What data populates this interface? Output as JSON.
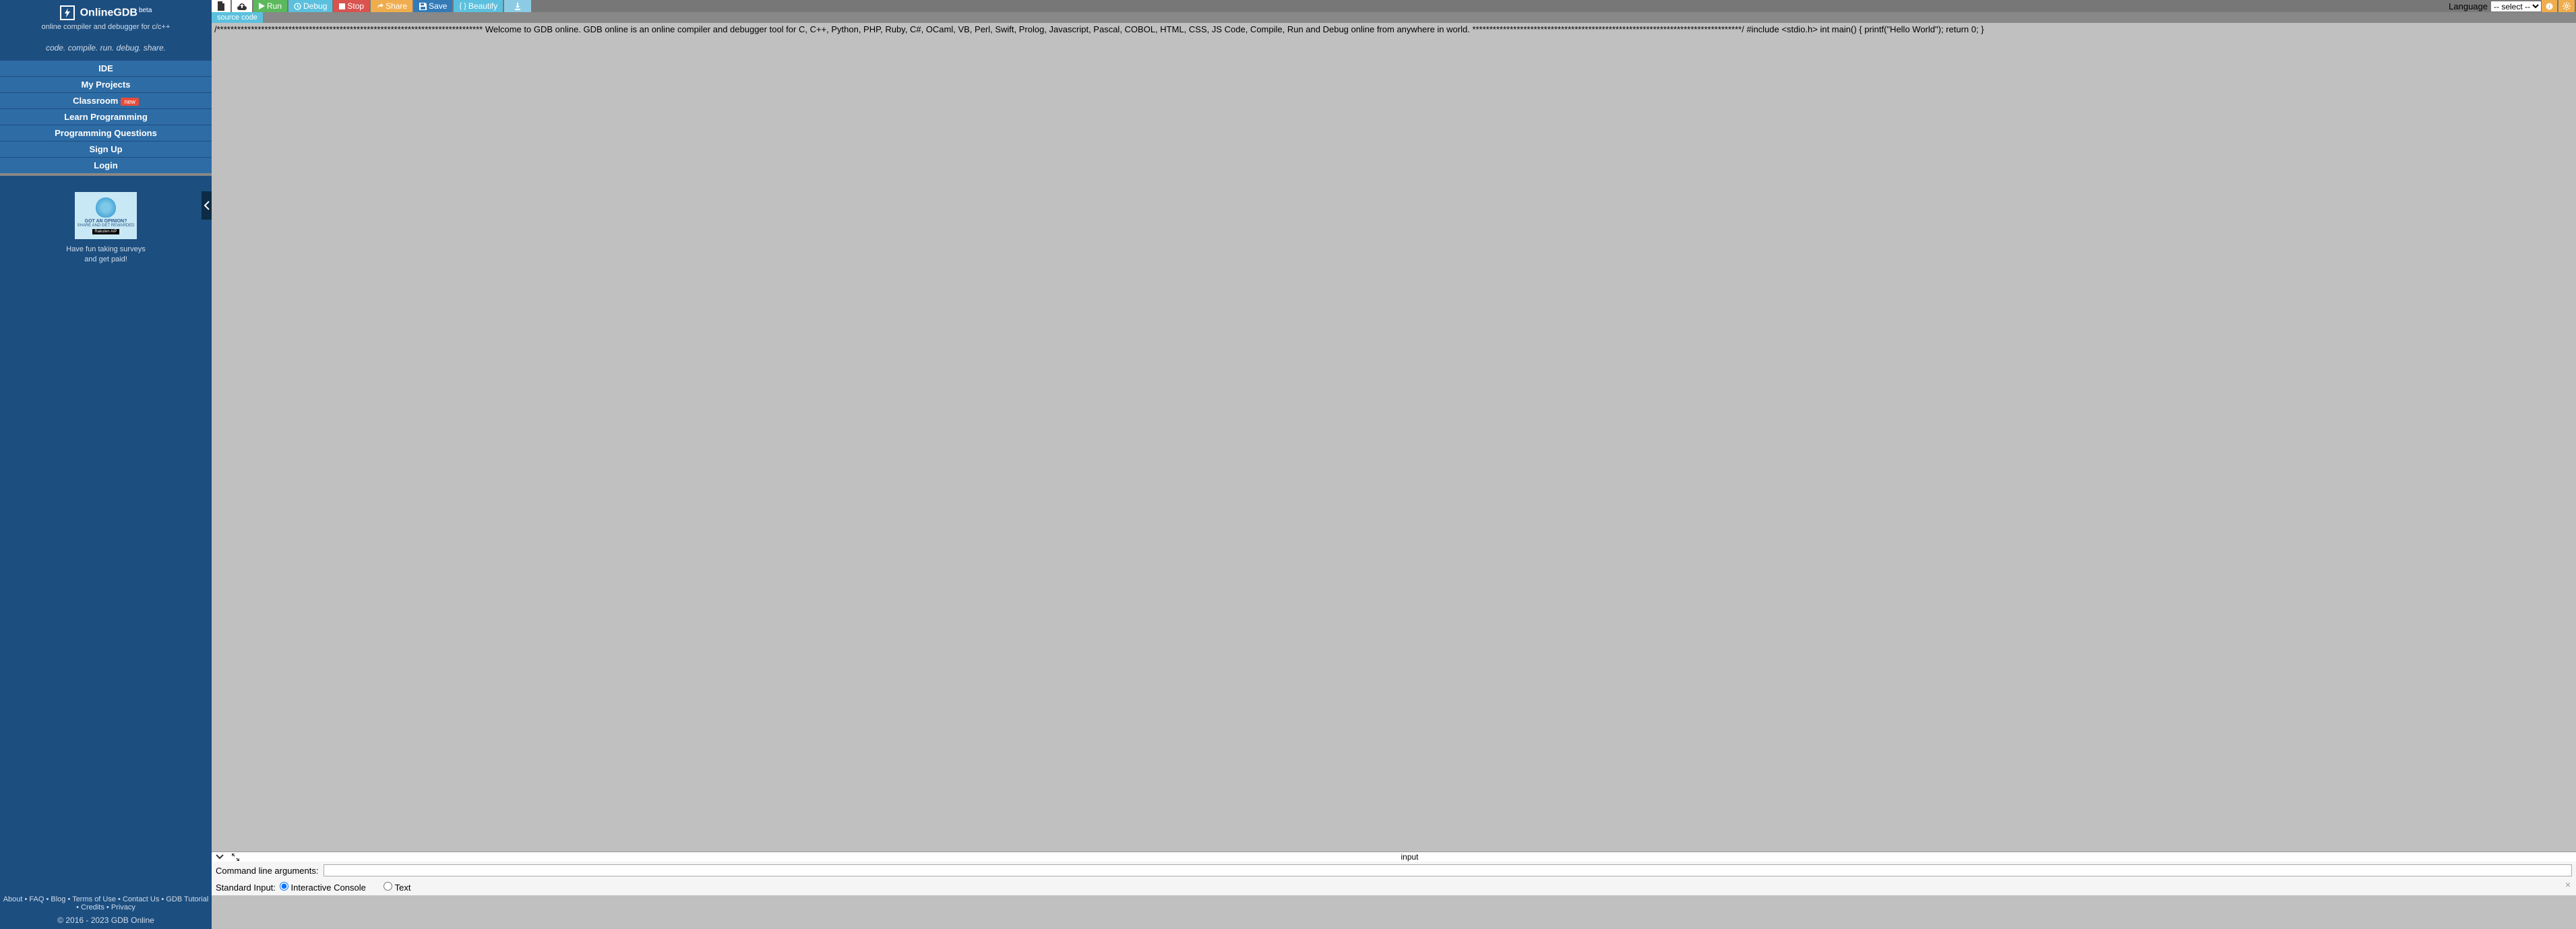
{
  "sidebar": {
    "title": "OnlineGDB",
    "beta": "beta",
    "subtitle": "online compiler and debugger for c/c++",
    "tagline": "code. compile. run. debug. share.",
    "nav": [
      "IDE",
      "My Projects",
      "Classroom",
      "Learn Programming",
      "Programming Questions",
      "Sign Up",
      "Login"
    ],
    "new_badge": "new",
    "ad": {
      "line1": "GOT AN OPINION?",
      "line2": "SHARE AND GET REWARDED",
      "brand": "Rakuten AIP",
      "caption1": "Have fun taking surveys",
      "caption2": "and get paid!"
    },
    "footer_links": [
      "About",
      "FAQ",
      "Blog",
      "Terms of Use",
      "Contact Us",
      "GDB Tutorial",
      "Credits",
      "Privacy"
    ],
    "copyright": "© 2016 - 2023 GDB Online"
  },
  "toolbar": {
    "run": "Run",
    "debug": "Debug",
    "stop": "Stop",
    "share": "Share",
    "save": "Save",
    "beautify": "Beautify",
    "language_label": "Language",
    "language_value": "-- select --"
  },
  "tab": {
    "label": "source code"
  },
  "editor": {
    "content": "/****************************************************************************** Welcome to GDB online. GDB online is an online compiler and debugger tool for C, C++, Python, PHP, Ruby, C#, OCaml, VB, Perl, Swift, Prolog, Javascript, Pascal, COBOL, HTML, CSS, JS Code, Compile, Run and Debug online from anywhere in world. *******************************************************************************/ #include <stdio.h> int main() { printf(\"Hello World\"); return 0; }"
  },
  "panel": {
    "title": "input",
    "cli_label": "Command line arguments:",
    "stdin_label": "Standard Input:",
    "opt_interactive": "Interactive Console",
    "opt_text": "Text"
  }
}
